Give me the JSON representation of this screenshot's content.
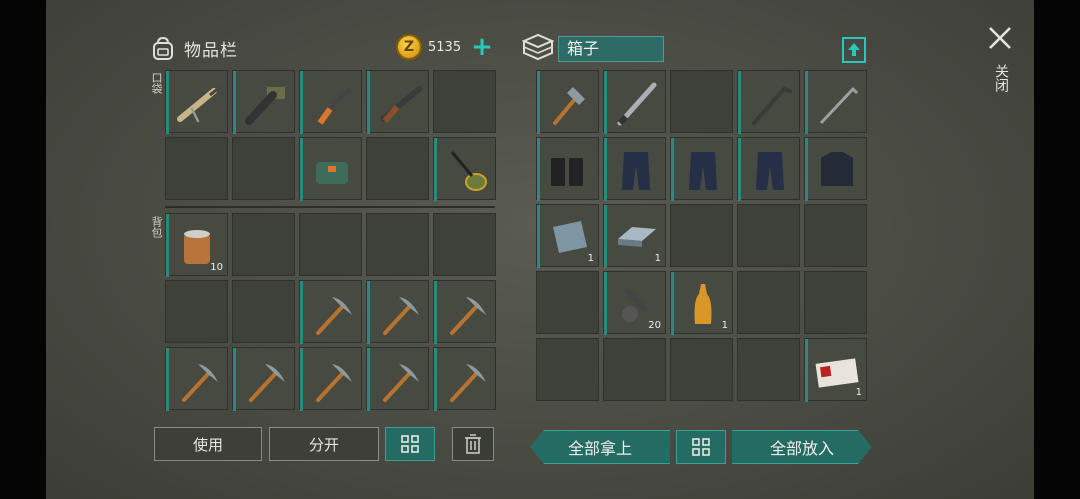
{
  "inventory": {
    "title": "物品栏",
    "money": "5135",
    "coin_symbol": "Z",
    "pocket_label": "口袋",
    "backpack_label": "背包"
  },
  "container": {
    "title": "箱子"
  },
  "close": {
    "label": "关闭"
  },
  "buttons": {
    "use": "使用",
    "split": "分开",
    "take_all": "全部拿上",
    "put_all": "全部放入"
  },
  "colors": {
    "accent": "#28c9b8",
    "teal_button": "#236b63",
    "panel": "#4a4c44"
  },
  "pockets": [
    {
      "icon": "assault-rifle-icon",
      "count": ""
    },
    {
      "icon": "grenade-launcher-icon",
      "count": ""
    },
    {
      "icon": "crossbow-icon",
      "count": ""
    },
    {
      "icon": "shotgun-icon",
      "count": ""
    },
    {
      "icon": "",
      "count": ""
    },
    {
      "icon": "",
      "count": ""
    },
    {
      "icon": "",
      "count": ""
    },
    {
      "icon": "first-aid-bag-icon",
      "count": ""
    },
    {
      "icon": "",
      "count": ""
    },
    {
      "icon": "metal-detector-icon",
      "count": ""
    }
  ],
  "backpack": [
    {
      "icon": "canned-food-icon",
      "count": "10"
    },
    {
      "icon": "",
      "count": ""
    },
    {
      "icon": "",
      "count": ""
    },
    {
      "icon": "",
      "count": ""
    },
    {
      "icon": "",
      "count": ""
    },
    {
      "icon": "",
      "count": ""
    },
    {
      "icon": "",
      "count": ""
    },
    {
      "icon": "pickaxe-icon",
      "count": ""
    },
    {
      "icon": "pickaxe-icon",
      "count": ""
    },
    {
      "icon": "pickaxe-icon",
      "count": ""
    },
    {
      "icon": "pickaxe-icon",
      "count": ""
    },
    {
      "icon": "pickaxe-icon",
      "count": ""
    },
    {
      "icon": "pickaxe-icon",
      "count": ""
    },
    {
      "icon": "pickaxe-icon",
      "count": ""
    },
    {
      "icon": "pickaxe-icon",
      "count": ""
    }
  ],
  "box": [
    {
      "icon": "shovel-icon",
      "count": ""
    },
    {
      "icon": "machete-icon",
      "count": ""
    },
    {
      "icon": "",
      "count": ""
    },
    {
      "icon": "crowbar-icon",
      "count": ""
    },
    {
      "icon": "golf-club-icon",
      "count": ""
    },
    {
      "icon": "boots-icon",
      "count": ""
    },
    {
      "icon": "pants-icon",
      "count": ""
    },
    {
      "icon": "pants-icon",
      "count": ""
    },
    {
      "icon": "pants-icon",
      "count": ""
    },
    {
      "icon": "tactical-vest-icon",
      "count": ""
    },
    {
      "icon": "metal-plate-icon",
      "count": "1"
    },
    {
      "icon": "iron-ingot-icon",
      "count": "1"
    },
    {
      "icon": "",
      "count": ""
    },
    {
      "icon": "",
      "count": ""
    },
    {
      "icon": "",
      "count": ""
    },
    {
      "icon": "",
      "count": ""
    },
    {
      "icon": "scrap-parts-icon",
      "count": "20"
    },
    {
      "icon": "soda-bottle-icon",
      "count": "1"
    },
    {
      "icon": "",
      "count": ""
    },
    {
      "icon": "",
      "count": ""
    },
    {
      "icon": "",
      "count": ""
    },
    {
      "icon": "",
      "count": ""
    },
    {
      "icon": "",
      "count": ""
    },
    {
      "icon": "",
      "count": ""
    },
    {
      "icon": "army-id-card-icon",
      "count": "1"
    }
  ]
}
